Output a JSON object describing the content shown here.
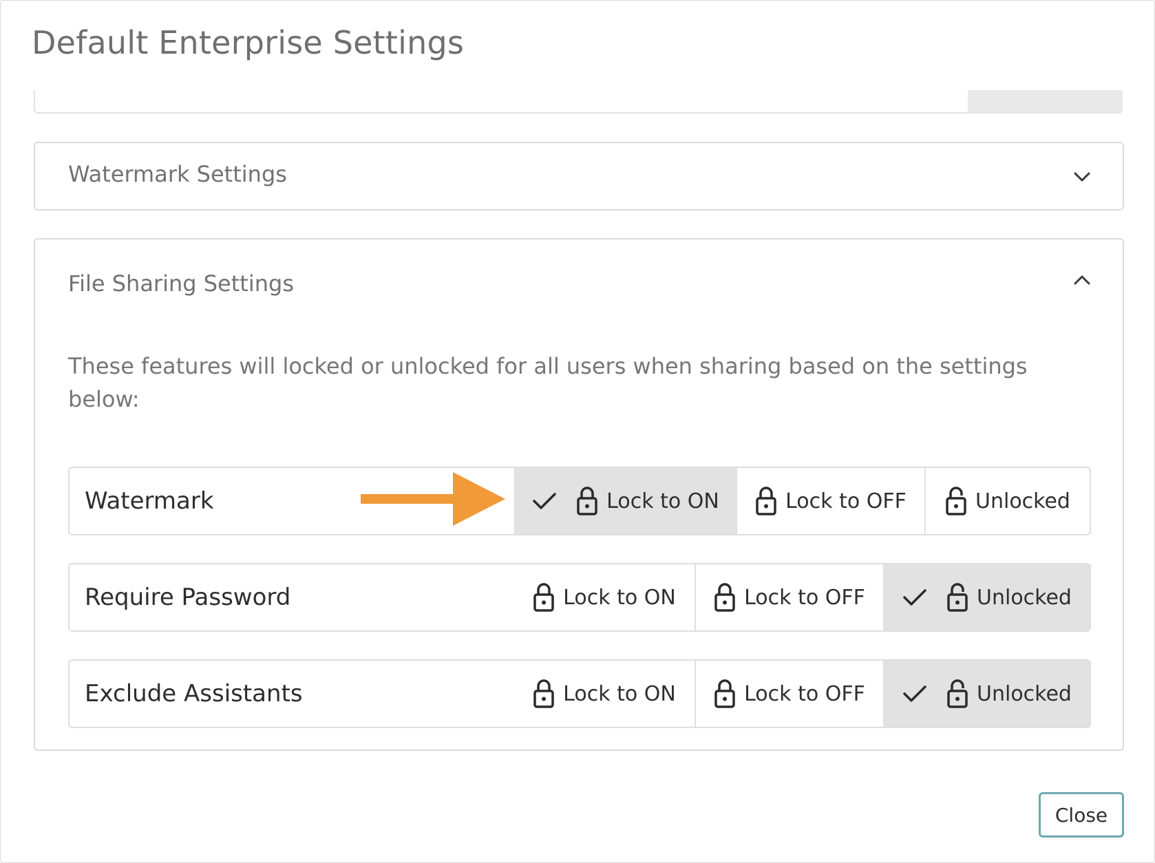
{
  "modal": {
    "title": "Default Enterprise Settings",
    "close_label": "Close"
  },
  "panels": {
    "watermark": {
      "title": "Watermark Settings",
      "expanded": false,
      "icon": "chevron-down-icon"
    },
    "file_sharing": {
      "title": "File Sharing Settings",
      "expanded": true,
      "icon": "chevron-up-icon",
      "description": "These features will locked or unlocked for all users when sharing based on the settings below:",
      "rows": [
        {
          "label": "Watermark",
          "options": [
            "Lock to ON",
            "Lock to OFF",
            "Unlocked"
          ],
          "selected": "Lock to ON"
        },
        {
          "label": "Require Password",
          "options": [
            "Lock to ON",
            "Lock to OFF",
            "Unlocked"
          ],
          "selected": "Unlocked"
        },
        {
          "label": "Exclude Assistants",
          "options": [
            "Lock to ON",
            "Lock to OFF",
            "Unlocked"
          ],
          "selected": "Unlocked"
        }
      ]
    }
  },
  "annotation": {
    "arrow_color": "#f19a38"
  },
  "colors": {
    "selected_bg": "#e2e2e2",
    "close_border": "#6ea8b0"
  }
}
